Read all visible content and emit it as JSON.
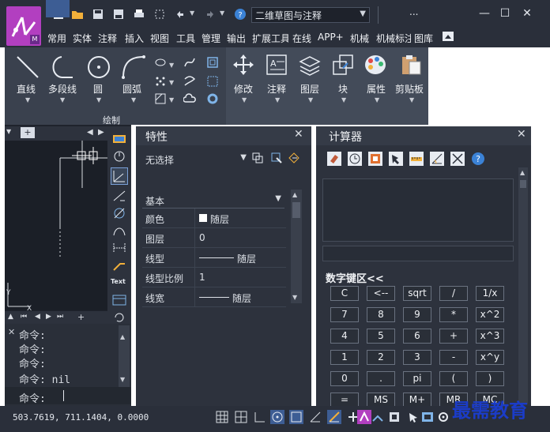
{
  "titlebar": {
    "doc_name": "二维草图与注释",
    "menu_extra": "..."
  },
  "menu": {
    "items": [
      "常用",
      "实体",
      "注释",
      "插入",
      "视图",
      "工具",
      "管理",
      "输出",
      "扩展工具",
      "在线",
      "APP+",
      "机械",
      "机械标注",
      "图库"
    ]
  },
  "ribbon": {
    "draw_tools": [
      "直线",
      "多段线",
      "圆",
      "圆弧"
    ],
    "modify_tools": [
      "修改",
      "注释",
      "图层",
      "块",
      "属性",
      "剪贴板"
    ],
    "panel_label": "绘制"
  },
  "properties": {
    "title": "特性",
    "selection": "无选择",
    "group": "基本",
    "rows": [
      {
        "key": "颜色",
        "value": "随层"
      },
      {
        "key": "图层",
        "value": "0"
      },
      {
        "key": "线型",
        "value": "随层"
      },
      {
        "key": "线型比例",
        "value": "1"
      },
      {
        "key": "线宽",
        "value": "随层"
      }
    ]
  },
  "calculator": {
    "title": "计算器",
    "keypad_label": "数字键区<<",
    "keys": [
      [
        "C",
        "<--",
        "sqrt",
        "/",
        "1/x"
      ],
      [
        "7",
        "8",
        "9",
        "*",
        "x^2"
      ],
      [
        "4",
        "5",
        "6",
        "+",
        "x^3"
      ],
      [
        "1",
        "2",
        "3",
        "-",
        "x^y"
      ],
      [
        "0",
        ".",
        "pi",
        "(",
        ")"
      ],
      [
        "=",
        "MS",
        "M+",
        "MR",
        "MC"
      ]
    ]
  },
  "command": {
    "lines": [
      "命令:",
      "命令:",
      "命令:",
      "命令: nil"
    ],
    "prompt": "命令:"
  },
  "status": {
    "coords": "503.7619, 711.1404, 0.0000"
  },
  "watermark": "最需教育",
  "vtool_text_label": "Text",
  "colors": {
    "ui_bg": "#2d323d",
    "ribbon_bg": "#3a414e",
    "accent_blue": "#3d5d94",
    "logo_purple": "#b23fc0",
    "watermark_blue": "#1b3cc8"
  }
}
